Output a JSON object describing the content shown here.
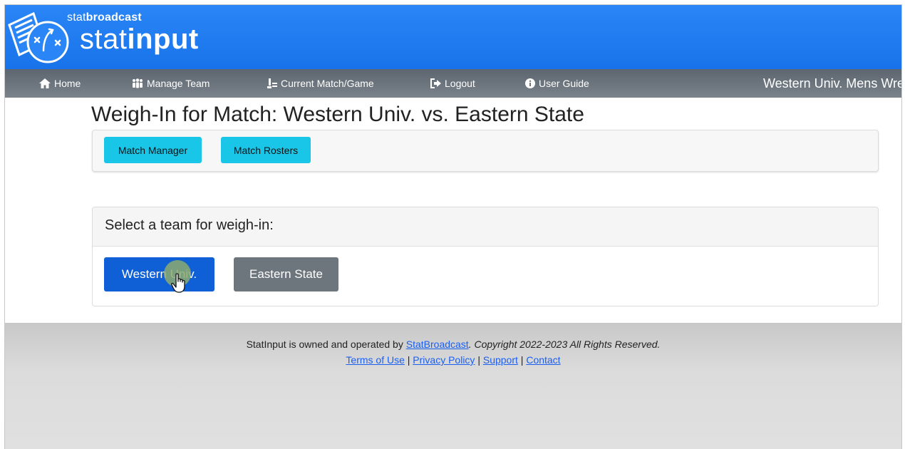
{
  "brand": {
    "small_prefix": "stat",
    "small_bold": "broadcast",
    "big_prefix": "stat",
    "big_bold": "input",
    "color": "#1f7ff0"
  },
  "nav": {
    "items": [
      {
        "label": "Home",
        "icon": "home-icon"
      },
      {
        "label": "Manage Team",
        "icon": "users-icon"
      },
      {
        "label": "Current Match/Game",
        "icon": "match-icon"
      },
      {
        "label": "Logout",
        "icon": "logout-icon"
      },
      {
        "label": "User Guide",
        "icon": "info-icon"
      }
    ],
    "team_name": "Western Univ. Mens Wre"
  },
  "page": {
    "title": "Weigh-In for Match: Western Univ. vs. Eastern State",
    "toolbar": {
      "match_manager": "Match Manager",
      "match_rosters": "Match Rosters"
    },
    "select_team": {
      "heading": "Select a team for weigh-in:",
      "team1": "Western Univ.",
      "team2": "Eastern State"
    }
  },
  "footer": {
    "owned_text": "StatInput is owned and operated by ",
    "owner_link": "StatBroadcast",
    "copyright": ". Copyright 2022-2023 All Rights Reserved.",
    "links": {
      "terms": "Terms of Use",
      "privacy": "Privacy Policy",
      "support": "Support",
      "contact": "Contact"
    },
    "separator": " | "
  },
  "colors": {
    "header": "#1f7ff0",
    "nav": "#6b747d",
    "cyan_button": "#1ac6e8",
    "primary_button": "#0f5fd6",
    "secondary_button": "#6d757d",
    "link": "#1a5ff0"
  }
}
